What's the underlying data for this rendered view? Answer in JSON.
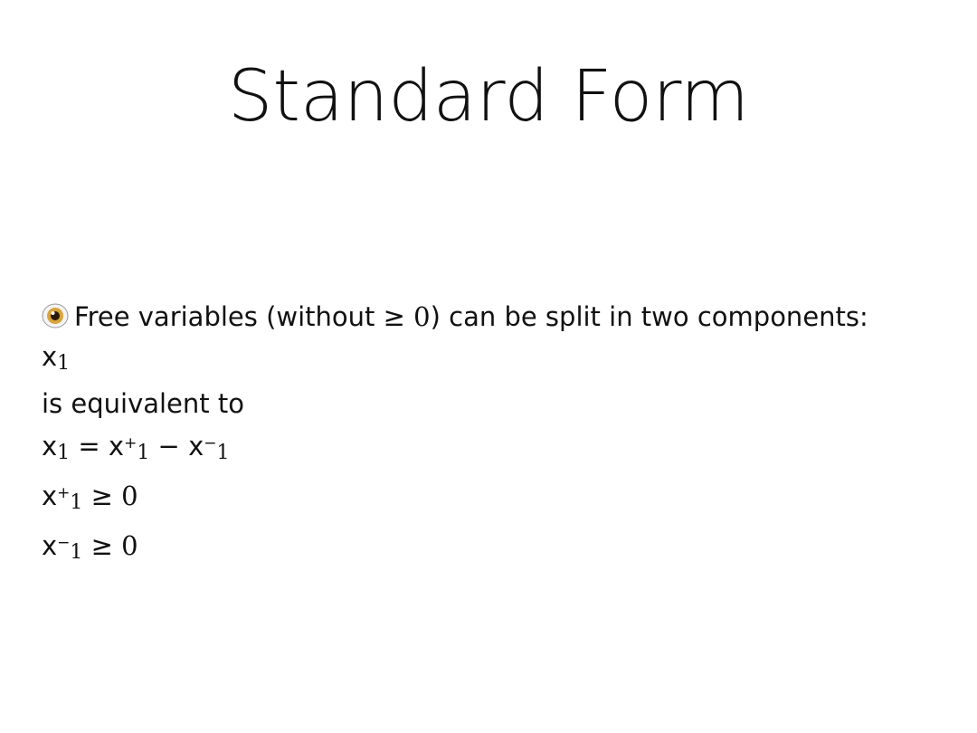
{
  "slide": {
    "title": "Standard Form",
    "bullet": {
      "icon": "eye-icon",
      "text_before": "Free variables (without ≥ ",
      "zero": "0",
      "text_after": ") can be split in two components:"
    },
    "lines": {
      "var": "x",
      "one": "1",
      "plus": "+",
      "minus_sup": "−",
      "equiv": "is equivalent to",
      "eq": " = ",
      "minus": " − ",
      "geq": " ≥ ",
      "zero": "0"
    }
  }
}
